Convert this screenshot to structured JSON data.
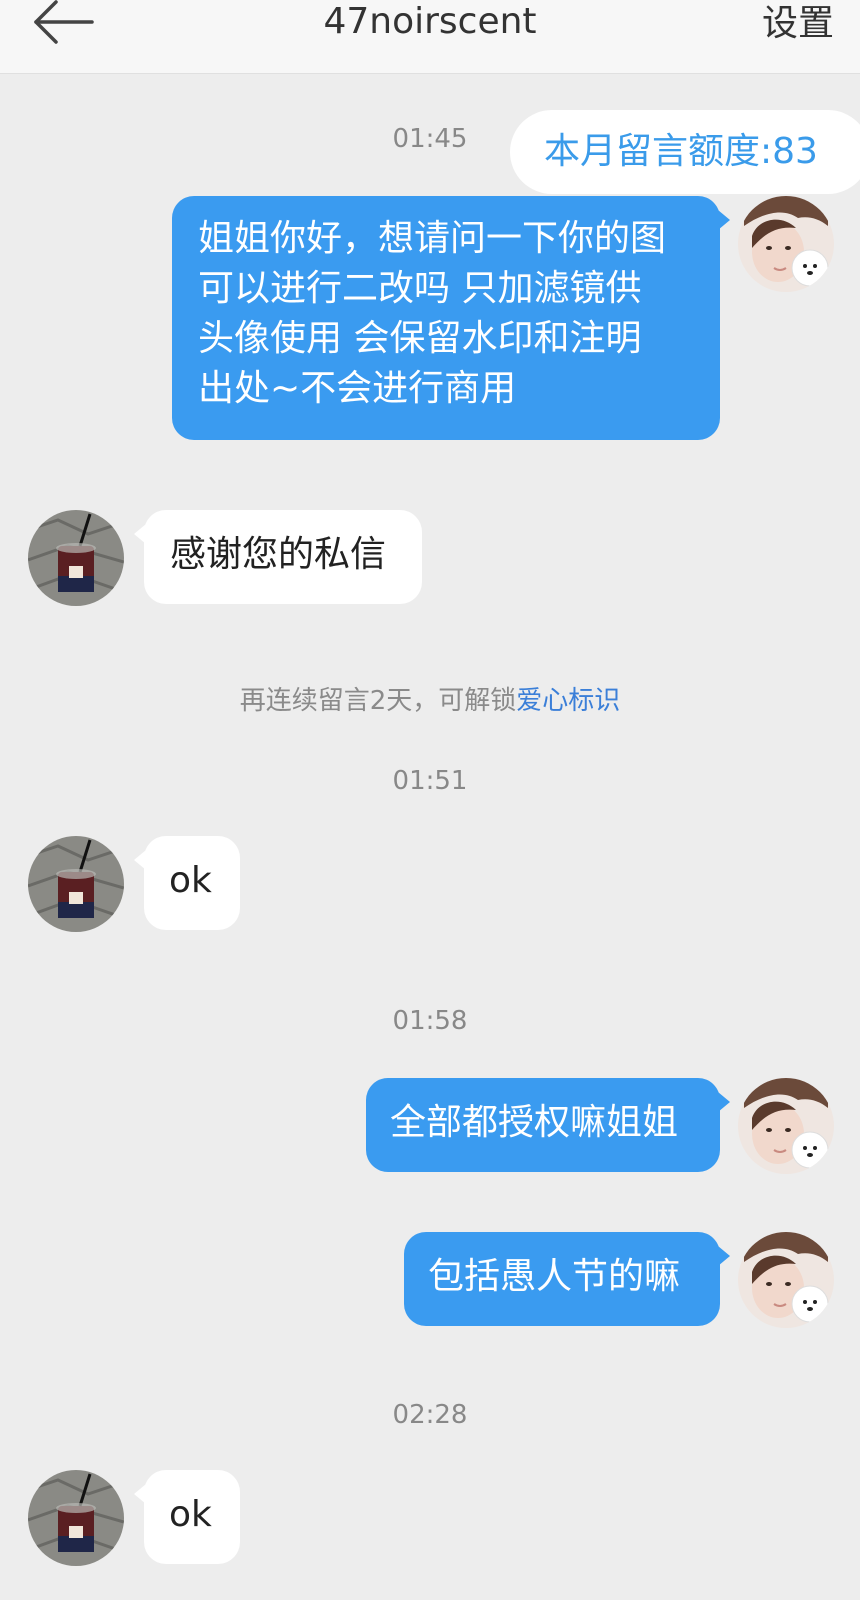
{
  "header": {
    "title": "47noirscent",
    "settings_label": "设置",
    "back_icon": "back-arrow-icon"
  },
  "quota": {
    "label": "本月留言额度:83"
  },
  "colors": {
    "sent_bubble": "#3a9bf0",
    "received_bubble": "#ffffff",
    "background": "#ededed",
    "quota_text": "#3a9bea",
    "link": "#3b7fd8"
  },
  "messages": [
    {
      "type": "time",
      "text": "01:45"
    },
    {
      "type": "sent",
      "text": "姐姐你好，想请问一下你的图\n可以进行二改吗 只加滤镜供\n头像使用 会保留水印和注明\n出处~不会进行商用"
    },
    {
      "type": "received",
      "text": "感谢您的私信"
    },
    {
      "type": "notice",
      "prefix": "再连续留言2天，可解锁",
      "link": "爱心标识"
    },
    {
      "type": "time",
      "text": "01:51"
    },
    {
      "type": "received",
      "text": "ok"
    },
    {
      "type": "time",
      "text": "01:58"
    },
    {
      "type": "sent",
      "text": "全部都授权嘛姐姐"
    },
    {
      "type": "sent",
      "text": "包括愚人节的嘛"
    },
    {
      "type": "time",
      "text": "02:28"
    },
    {
      "type": "received",
      "text": "ok"
    }
  ]
}
